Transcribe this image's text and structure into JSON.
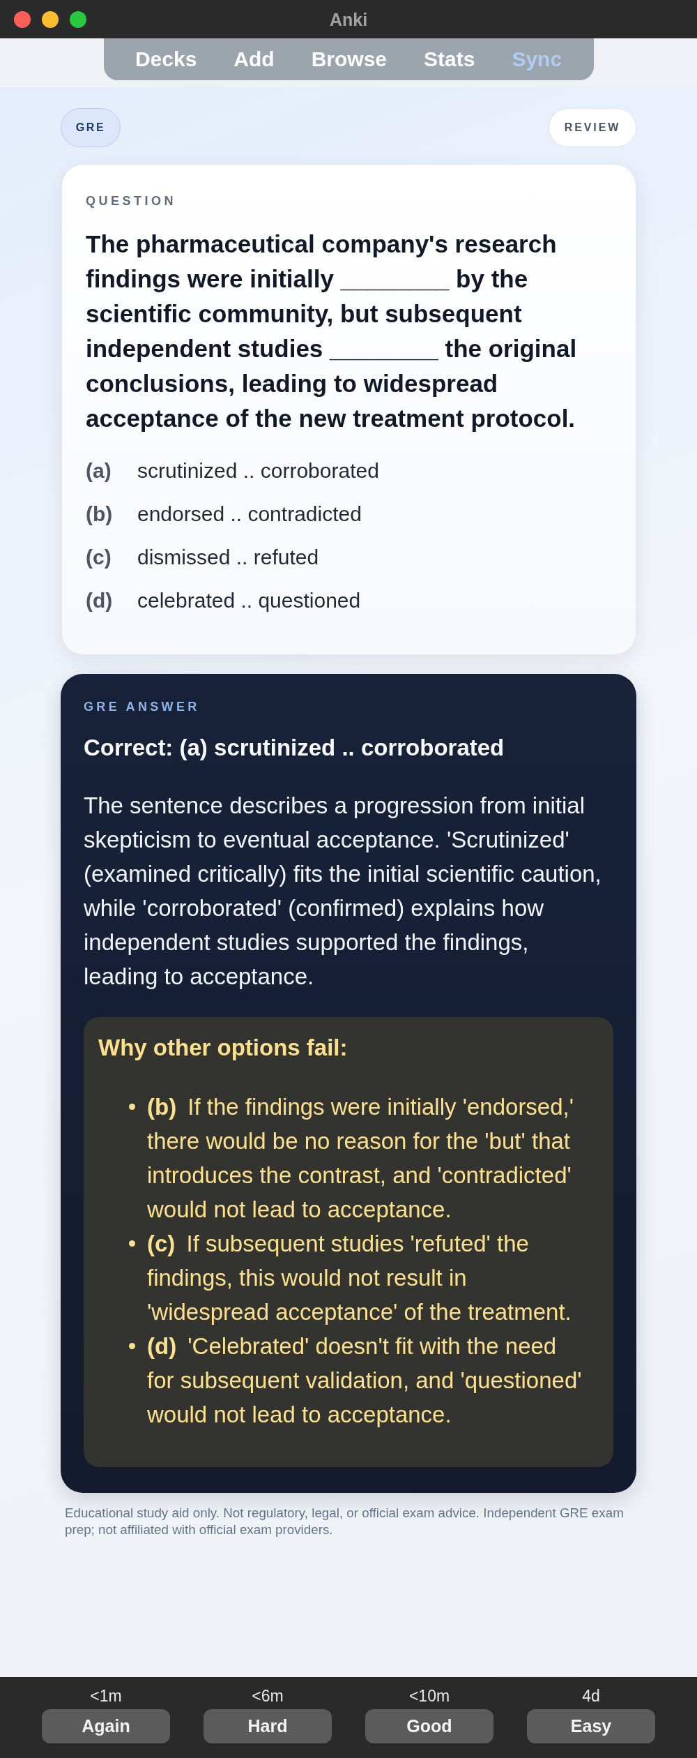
{
  "window": {
    "title": "Anki"
  },
  "toolbar": {
    "items": [
      {
        "label": "Decks",
        "highlighted": false
      },
      {
        "label": "Add",
        "highlighted": false
      },
      {
        "label": "Browse",
        "highlighted": false
      },
      {
        "label": "Stats",
        "highlighted": false
      },
      {
        "label": "Sync",
        "highlighted": true
      }
    ]
  },
  "card_header": {
    "deck_tag": "GRE",
    "mode_tag": "REVIEW"
  },
  "question": {
    "label": "QUESTION",
    "text": "The pharmaceutical company's research findings were initially ________ by the scientific community, but subsequent independent studies ________ the original conclusions, leading to widespread acceptance of the new treatment protocol.",
    "options": [
      {
        "label": "(a)",
        "text": "scrutinized .. corroborated"
      },
      {
        "label": "(b)",
        "text": "endorsed .. contradicted"
      },
      {
        "label": "(c)",
        "text": "dismissed .. refuted"
      },
      {
        "label": "(d)",
        "text": "celebrated .. questioned"
      }
    ]
  },
  "answer": {
    "label": "GRE ANSWER",
    "correct": "Correct: (a) scrutinized .. corroborated",
    "explanation": "The sentence describes a progression from initial skepticism to eventual acceptance. 'Scrutinized' (examined critically) fits the initial scientific caution, while 'corroborated' (confirmed) explains how independent studies supported the findings, leading to acceptance.",
    "why_others_fail": {
      "title": "Why other options fail:",
      "items": [
        {
          "label": "(b)",
          "text": "If the findings were initially 'endorsed,' there would be no reason for the 'but' that introduces the contrast, and 'contradicted' would not lead to acceptance."
        },
        {
          "label": "(c)",
          "text": "If subsequent studies 'refuted' the findings, this would not result in 'widespread acceptance' of the treatment."
        },
        {
          "label": "(d)",
          "text": "'Celebrated' doesn't fit with the need for subsequent validation, and 'questioned' would not lead to acceptance."
        }
      ]
    }
  },
  "disclaimer": "Educational study aid only. Not regulatory, legal, or official exam advice. Independent GRE exam prep; not affiliated with official exam providers.",
  "answer_buttons": [
    {
      "interval": "<1m",
      "label": "Again"
    },
    {
      "interval": "<6m",
      "label": "Hard"
    },
    {
      "interval": "<10m",
      "label": "Good"
    },
    {
      "interval": "4d",
      "label": "Easy"
    }
  ]
}
